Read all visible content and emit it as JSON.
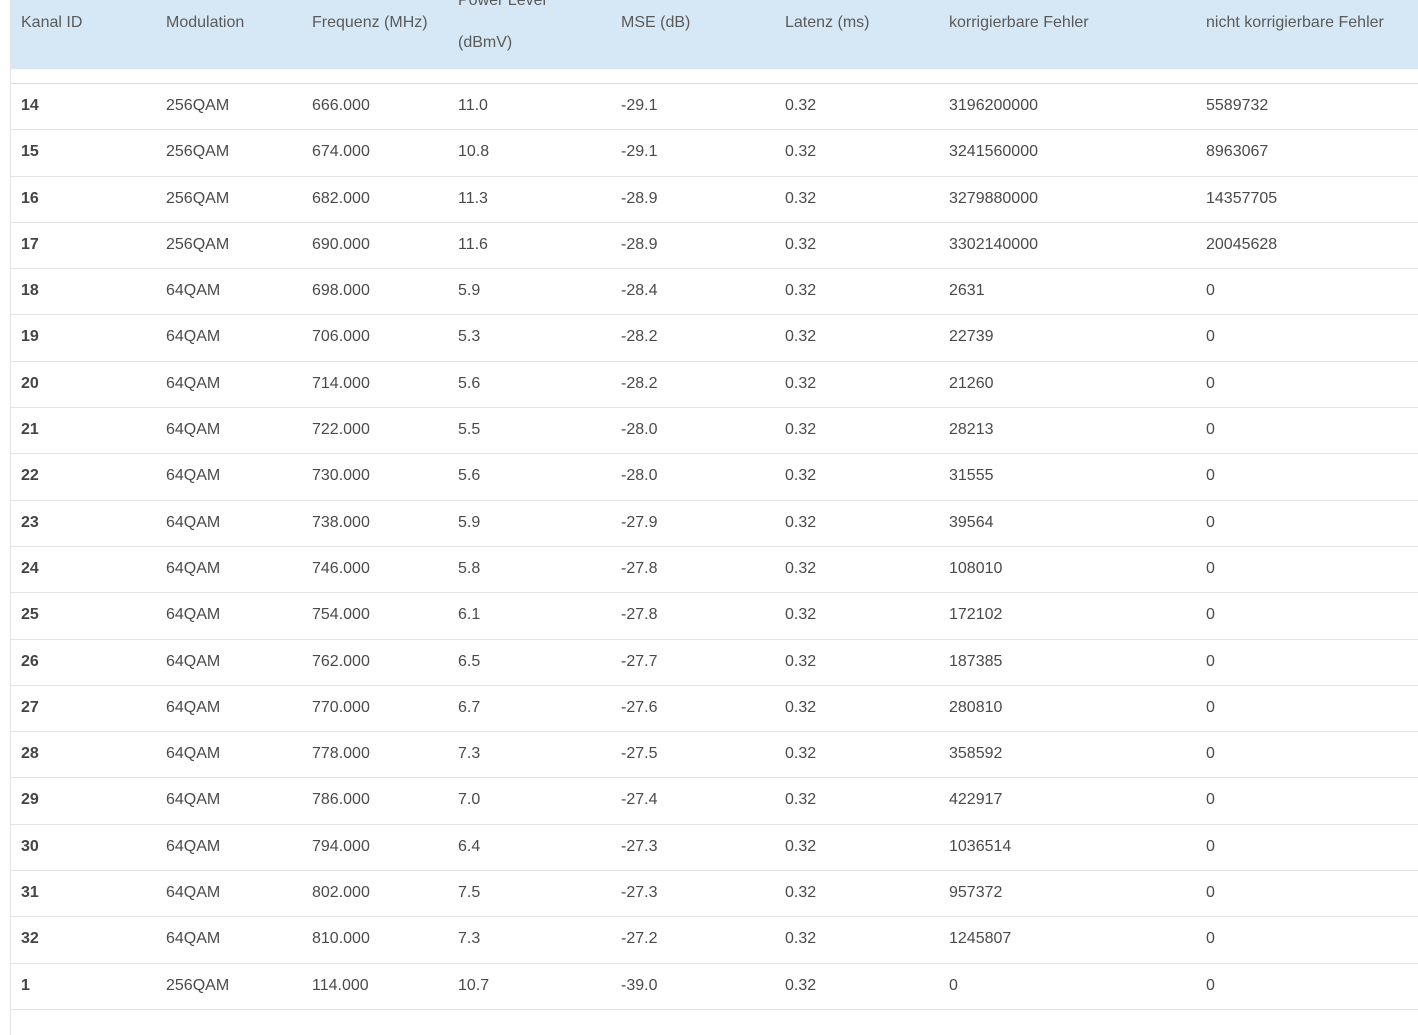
{
  "table": {
    "headers": {
      "kanal_id": "Kanal ID",
      "modulation": "Modulation",
      "frequenz": "Frequenz (MHz)",
      "power_level_line1": "Power Level",
      "power_level_line2": "(dBmV)",
      "mse": "MSE (dB)",
      "latenz": "Latenz (ms)",
      "korrigierbare": "korrigierbare Fehler",
      "nicht_korrigierbare": "nicht korrigierbare Fehler"
    },
    "rows": [
      {
        "id": "14",
        "modulation": "256QAM",
        "freq": "666.000",
        "power": "11.0",
        "mse": "-29.1",
        "latency": "0.32",
        "corr": "3196200000",
        "uncorr": "5589732"
      },
      {
        "id": "15",
        "modulation": "256QAM",
        "freq": "674.000",
        "power": "10.8",
        "mse": "-29.1",
        "latency": "0.32",
        "corr": "3241560000",
        "uncorr": "8963067"
      },
      {
        "id": "16",
        "modulation": "256QAM",
        "freq": "682.000",
        "power": "11.3",
        "mse": "-28.9",
        "latency": "0.32",
        "corr": "3279880000",
        "uncorr": "14357705"
      },
      {
        "id": "17",
        "modulation": "256QAM",
        "freq": "690.000",
        "power": "11.6",
        "mse": "-28.9",
        "latency": "0.32",
        "corr": "3302140000",
        "uncorr": "20045628"
      },
      {
        "id": "18",
        "modulation": "64QAM",
        "freq": "698.000",
        "power": "5.9",
        "mse": "-28.4",
        "latency": "0.32",
        "corr": "2631",
        "uncorr": "0"
      },
      {
        "id": "19",
        "modulation": "64QAM",
        "freq": "706.000",
        "power": "5.3",
        "mse": "-28.2",
        "latency": "0.32",
        "corr": "22739",
        "uncorr": "0"
      },
      {
        "id": "20",
        "modulation": "64QAM",
        "freq": "714.000",
        "power": "5.6",
        "mse": "-28.2",
        "latency": "0.32",
        "corr": "21260",
        "uncorr": "0"
      },
      {
        "id": "21",
        "modulation": "64QAM",
        "freq": "722.000",
        "power": "5.5",
        "mse": "-28.0",
        "latency": "0.32",
        "corr": "28213",
        "uncorr": "0"
      },
      {
        "id": "22",
        "modulation": "64QAM",
        "freq": "730.000",
        "power": "5.6",
        "mse": "-28.0",
        "latency": "0.32",
        "corr": "31555",
        "uncorr": "0"
      },
      {
        "id": "23",
        "modulation": "64QAM",
        "freq": "738.000",
        "power": "5.9",
        "mse": "-27.9",
        "latency": "0.32",
        "corr": "39564",
        "uncorr": "0"
      },
      {
        "id": "24",
        "modulation": "64QAM",
        "freq": "746.000",
        "power": "5.8",
        "mse": "-27.8",
        "latency": "0.32",
        "corr": "108010",
        "uncorr": "0"
      },
      {
        "id": "25",
        "modulation": "64QAM",
        "freq": "754.000",
        "power": "6.1",
        "mse": "-27.8",
        "latency": "0.32",
        "corr": "172102",
        "uncorr": "0"
      },
      {
        "id": "26",
        "modulation": "64QAM",
        "freq": "762.000",
        "power": "6.5",
        "mse": "-27.7",
        "latency": "0.32",
        "corr": "187385",
        "uncorr": "0"
      },
      {
        "id": "27",
        "modulation": "64QAM",
        "freq": "770.000",
        "power": "6.7",
        "mse": "-27.6",
        "latency": "0.32",
        "corr": "280810",
        "uncorr": "0"
      },
      {
        "id": "28",
        "modulation": "64QAM",
        "freq": "778.000",
        "power": "7.3",
        "mse": "-27.5",
        "latency": "0.32",
        "corr": "358592",
        "uncorr": "0"
      },
      {
        "id": "29",
        "modulation": "64QAM",
        "freq": "786.000",
        "power": "7.0",
        "mse": "-27.4",
        "latency": "0.32",
        "corr": "422917",
        "uncorr": "0"
      },
      {
        "id": "30",
        "modulation": "64QAM",
        "freq": "794.000",
        "power": "6.4",
        "mse": "-27.3",
        "latency": "0.32",
        "corr": "1036514",
        "uncorr": "0"
      },
      {
        "id": "31",
        "modulation": "64QAM",
        "freq": "802.000",
        "power": "7.5",
        "mse": "-27.3",
        "latency": "0.32",
        "corr": "957372",
        "uncorr": "0"
      },
      {
        "id": "32",
        "modulation": "64QAM",
        "freq": "810.000",
        "power": "7.3",
        "mse": "-27.2",
        "latency": "0.32",
        "corr": "1245807",
        "uncorr": "0"
      },
      {
        "id": "1",
        "modulation": "256QAM",
        "freq": "114.000",
        "power": "10.7",
        "mse": "-39.0",
        "latency": "0.32",
        "corr": "0",
        "uncorr": "0"
      }
    ]
  }
}
